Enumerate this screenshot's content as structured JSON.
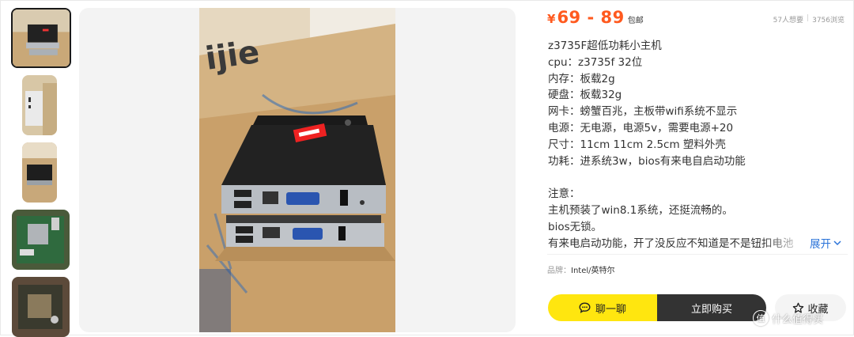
{
  "price": {
    "currency": "¥",
    "range": "69 - 89",
    "shipping": "包邮"
  },
  "stats": {
    "wants": "57人想要",
    "views": "3756浏览"
  },
  "description": {
    "specs": [
      "z3735F超低功耗小主机",
      "cpu：z3735f 32位",
      "内存：板载2g",
      "硬盘：板载32g",
      "网卡：螃蟹百兆，主板带wifi系统不显示",
      "电源：无电源，电源5v，需要电源+20",
      "尺寸：11cm 11cm 2.5cm 塑料外壳",
      "功耗：进系统3w，bios有来电自启动功能"
    ],
    "notes": [
      "注意：",
      "主机预装了win8.1系统，还挺流畅的。",
      "bios无锁。",
      "有来电启动功能，开了没反应不知道是不是钮扣电池"
    ],
    "expand_label": "展开"
  },
  "brand": {
    "label": "品牌：",
    "value": "Intel/英特尔"
  },
  "actions": {
    "chat_label": "聊一聊",
    "buy_label": "立即购买",
    "favorite_label": "收藏"
  },
  "watermark": {
    "text": "什么值得买",
    "icon_text": "值"
  },
  "photo": {
    "box_text": "ijie"
  },
  "colors": {
    "price": "#ff5a1f",
    "chat_button": "#ffe60f",
    "buy_button": "#333333",
    "expand_link": "#2a73d9"
  },
  "icons": [
    "chat-bubble-icon",
    "star-icon",
    "chevron-down-icon",
    "watermark-logo-icon"
  ]
}
